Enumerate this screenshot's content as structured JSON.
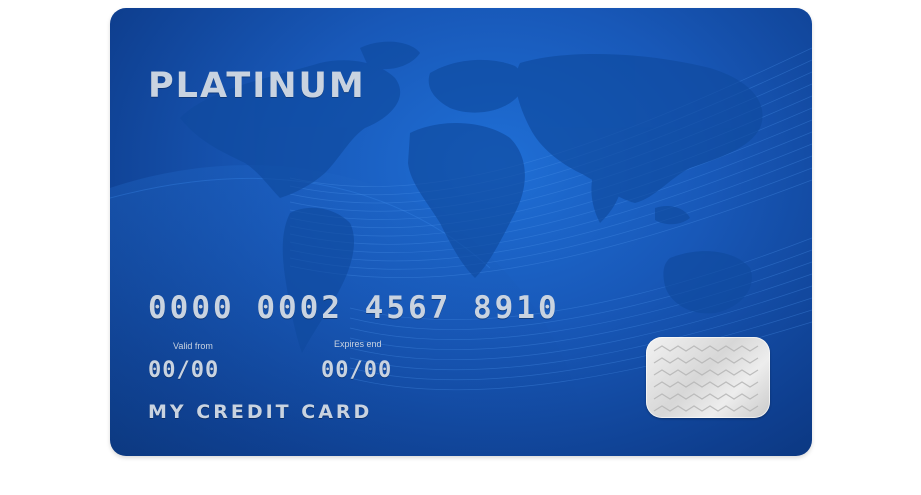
{
  "card": {
    "brand": "PLATINUM",
    "number": "0000 0002 4567 8910",
    "valid_from_label": "Valid  from",
    "valid_from_value": "00/00",
    "expires_label": "Expires  end",
    "expires_value": "00/00",
    "holder": "MY CREDIT CARD"
  },
  "colors": {
    "card_base": "#1858b8",
    "card_dark": "#0a3479",
    "text": "#c9d3e0",
    "chip": "#d7d7d7"
  },
  "icons": {
    "background": "world-map-icon",
    "chip": "chip-icon"
  }
}
